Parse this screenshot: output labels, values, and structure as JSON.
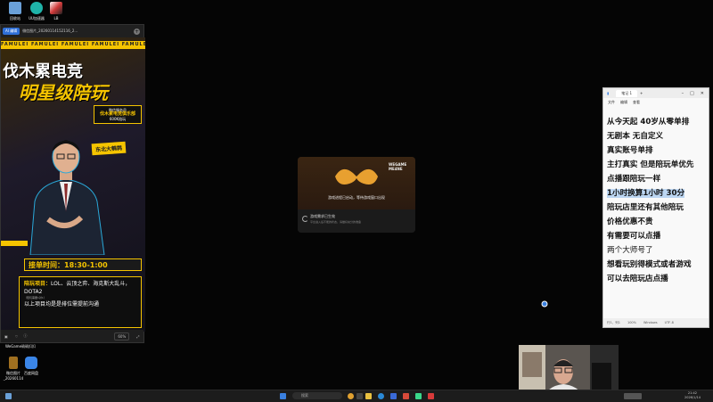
{
  "desktop": {
    "top_icons": [
      {
        "label": "回收站",
        "color": "#6aa0d8"
      },
      {
        "label": "UU加速器",
        "color": "#1fb3a8"
      },
      {
        "label": "LB",
        "color": "#d23a3a"
      }
    ],
    "left_icons": [
      {
        "label": "WeGame",
        "color": "#d8a020"
      },
      {
        "label": "微信图片_20260114",
        "color": "#a07020"
      },
      {
        "label": "百度网盘",
        "color": "#3b86e8"
      }
    ],
    "mid_label": "确确扣扣"
  },
  "viewer": {
    "tab_label": "AI 编辑",
    "file_name": "微信图片_20260114152116_2...",
    "zoom": "60%",
    "poster": {
      "stripe_text": "FAMULEI FAMULEI FAMULEI FAMULEI FAMULEI FAMULEI",
      "title1": "伐木累电竞",
      "title2": "明星级陪玩",
      "badge_line1": "微信服务员",
      "badge_line2": "伐木累电竞俱乐部",
      "badge_line3": "600K陪玩",
      "chip": "东北大鹌鹑",
      "time_text": "接单时间：18:30-1:00",
      "info_label": "陪玩项目：",
      "info_games": "LOL、云顶之弈、海克斯大乱斗，DOTA2",
      "info_small": "（陪玩需要1对1）",
      "info_tail": "以上项目均是是排位需提前沟通"
    }
  },
  "dialog": {
    "brand": "WEGAME ME4NE",
    "hero_text": "游戏进程已启动，等待游戏窗口出现",
    "status_title": "游戏需求已生效",
    "status_sub": "平台进入后不能的状态，请做好充分的准备",
    "accent": "#e8a030"
  },
  "notepad": {
    "tab": "笔记 1",
    "menu": [
      "文件",
      "编辑",
      "查看"
    ],
    "lines": [
      {
        "text": "从今天起 40岁从零单排",
        "style": "bold"
      },
      {
        "text": "无剧本 无自定义",
        "style": "bold"
      },
      {
        "text": "真实账号单排",
        "style": "bold"
      },
      {
        "text": "主打真实 但是陪玩单优先",
        "style": "bold"
      },
      {
        "text": "点播跟陪玩一样",
        "style": "bold"
      },
      {
        "text": "1小时换算1小时 30分",
        "style": "selected"
      },
      {
        "text": "陪玩店里还有其他陪玩",
        "style": "bold"
      },
      {
        "text": "价格优惠不贵",
        "style": "bold"
      },
      {
        "text": "有需要可以点播",
        "style": "bold"
      },
      {
        "text": "两个大师号了",
        "style": "plain"
      },
      {
        "text": "想看玩别得模式或者游戏",
        "style": "bold"
      },
      {
        "text": "可以去陪玩店点播",
        "style": "bold"
      }
    ],
    "status": [
      "行1，列1",
      "100%",
      "Windows",
      "UTF-8"
    ]
  },
  "taskbar": {
    "search_placeholder": "搜索",
    "time": "21:42",
    "date": "2026/1/14"
  }
}
